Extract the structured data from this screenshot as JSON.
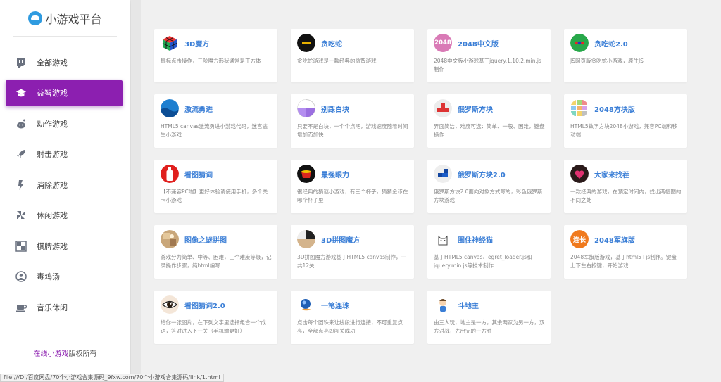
{
  "sidebar": {
    "logo_text": "小游戏平台",
    "items": [
      {
        "label": "全部游戏",
        "icon": "twitch-icon"
      },
      {
        "label": "益智游戏",
        "icon": "graduation-cap-icon",
        "active": true
      },
      {
        "label": "动作游戏",
        "icon": "reddit-icon"
      },
      {
        "label": "射击游戏",
        "icon": "rocket-icon"
      },
      {
        "label": "消除游戏",
        "icon": "lightning-icon"
      },
      {
        "label": "休闲游戏",
        "icon": "pinwheel-icon"
      },
      {
        "label": "棋牌游戏",
        "icon": "chessboard-icon"
      },
      {
        "label": "毒鸡汤",
        "icon": "user-icon"
      },
      {
        "label": "音乐休闲",
        "icon": "coffee-cup-icon"
      }
    ],
    "copyright_hl": "在线小游戏",
    "copyright_rest": "版权所有"
  },
  "accent": "#8c1fb0",
  "title_color": "#3a7ed6",
  "games": [
    {
      "title": "3D魔方",
      "desc": "鼠标点击操作，三阶魔方形状通常是正方体",
      "thumb": "rubiks-cube"
    },
    {
      "title": "贪吃蛇",
      "desc": "贪吃蛇游戏是一款经典的益智游戏",
      "thumb": "snake-black"
    },
    {
      "title": "2048中文版",
      "desc": "2048中文版小游戏基于jquery.1.10.2.min.js制作",
      "thumb": "badge-2048"
    },
    {
      "title": "贪吃蛇2.0",
      "desc": "JS网页版贪吃蛇小游戏，原生JS",
      "thumb": "snake-green"
    },
    {
      "title": "激流勇进",
      "desc": "HTML5 canvas激流勇进小游戏代码，迷宫逃生小游戏",
      "thumb": "blue-waves"
    },
    {
      "title": "别踩白块",
      "desc": "只要不是白块，一个个点吧，游戏速度随着时间增加而加快",
      "thumb": "purple-quarter"
    },
    {
      "title": "俄罗斯方块",
      "desc": "界面简洁，难度可选：简单、一般、困难，键盘操作",
      "thumb": "tetris-red"
    },
    {
      "title": "2048方块版",
      "desc": "HTML5数字方块2048小游戏，兼容PC端和移动端",
      "thumb": "color-grid"
    },
    {
      "title": "看图猜词",
      "desc": "【不兼容PC端】更好体验请使用手机，多个关卡小游戏",
      "thumb": "red-bottle"
    },
    {
      "title": "最强眼力",
      "desc": "很经典的猜谜小游戏，有三个杯子，猜猜金币在哪个杯子里",
      "thumb": "red-cup"
    },
    {
      "title": "俄罗斯方块2.0",
      "desc": "俄罗斯方块2.0面向对象方式写的，彩色俄罗斯方块游戏",
      "thumb": "tetris-blue"
    },
    {
      "title": "大家来找茬",
      "desc": "一款经典的游戏，在预定时间内，找出两幅图的不同之处",
      "thumb": "heart-dark"
    },
    {
      "title": "图像之谜拼图",
      "desc": "游戏分为简单、中等、困难，三个难度等级，记录操作步骤，纯html编写",
      "thumb": "photo-puzzle"
    },
    {
      "title": "3D拼图魔方",
      "desc": "3D拼图魔方游戏基于HTML5 canvas制作，一共12关",
      "thumb": "tan-pie"
    },
    {
      "title": "围住神经猫",
      "desc": "基于HTML5 canvas、egret_loader.js和jquery.min.js等技术制作",
      "thumb": "cat-outline"
    },
    {
      "title": "2048军旗版",
      "desc": "2048军旗版游戏，基于html5+js制作。键盘上下左右按键，开始游戏",
      "thumb": "orange-lianzhang"
    },
    {
      "title": "看图猜词2.0",
      "desc": "给你一张图片，在下列文字里选择组合一个成语，答对进入下一关（手机端更好）",
      "thumb": "eye"
    },
    {
      "title": "一笔连珠",
      "desc": "点击每个圆珠来让线段进行连接，不可重复点亮，全部点亮即闯关成功",
      "thumb": "blue-ball"
    },
    {
      "title": "斗地主",
      "desc": "由三人玩，地主是一方，其余两家为另一方，双方对战，先出完的一方胜",
      "thumb": "cartoon-boy"
    }
  ],
  "thumb_text": {
    "badge_2048": "2048",
    "lianzhang": "连长"
  },
  "status_bar": "file:///D:/百度网盘/70个小游戏合集源码_9fxw.com/70个小游戏合集源码/link/1.html"
}
